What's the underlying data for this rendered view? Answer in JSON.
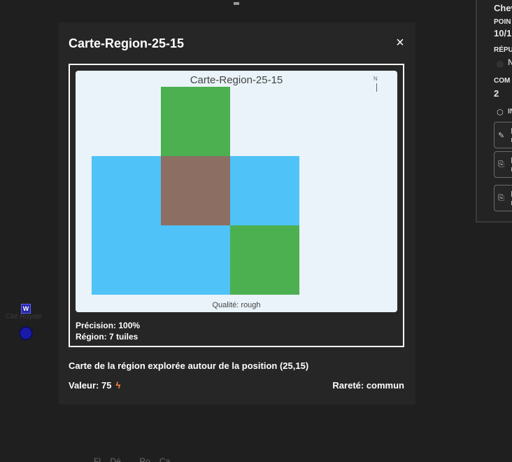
{
  "modal": {
    "title": "Carte-Region-25-15",
    "close_label": "×",
    "map": {
      "caption": "Carte-Region-25-15",
      "compass": "N",
      "quality": "Qualité: rough",
      "tiles": [
        {
          "col": 1,
          "row": 0,
          "terrain": "green"
        },
        {
          "col": 0,
          "row": 1,
          "terrain": "blue"
        },
        {
          "col": 1,
          "row": 1,
          "terrain": "brown"
        },
        {
          "col": 2,
          "row": 1,
          "terrain": "blue"
        },
        {
          "col": 0,
          "row": 2,
          "terrain": "blue"
        },
        {
          "col": 1,
          "row": 2,
          "terrain": "blue"
        },
        {
          "col": 2,
          "row": 2,
          "terrain": "green"
        }
      ],
      "colors": {
        "green": "#4caf50",
        "blue": "#4fc3f7",
        "brown": "#8d6e63"
      }
    },
    "precision": "Précision: 100%",
    "region": "Région: 7 tuiles",
    "description": "Carte de la région explorée autour de la position (25,15)",
    "value": "Valeur: 75",
    "value_icon": "lightning-icon",
    "rarity": "Rareté: commun"
  },
  "side_panel": {
    "name": "Chev",
    "points_label": "POIN",
    "points_value": "10/1",
    "reputation_label": "RÉPU",
    "reputation_value": "N",
    "comp_label": "COM",
    "comp_value": "2",
    "inventory_label": "IN",
    "inventory_icon": "cube-icon",
    "items": [
      "pencil-icon",
      "scroll-icon",
      "scroll-icon"
    ]
  },
  "map_marker": {
    "badge": "W",
    "label": "Cité Royale"
  },
  "bottom_legend": "Fl...  Dé...  ...  Ro...  Ca..."
}
